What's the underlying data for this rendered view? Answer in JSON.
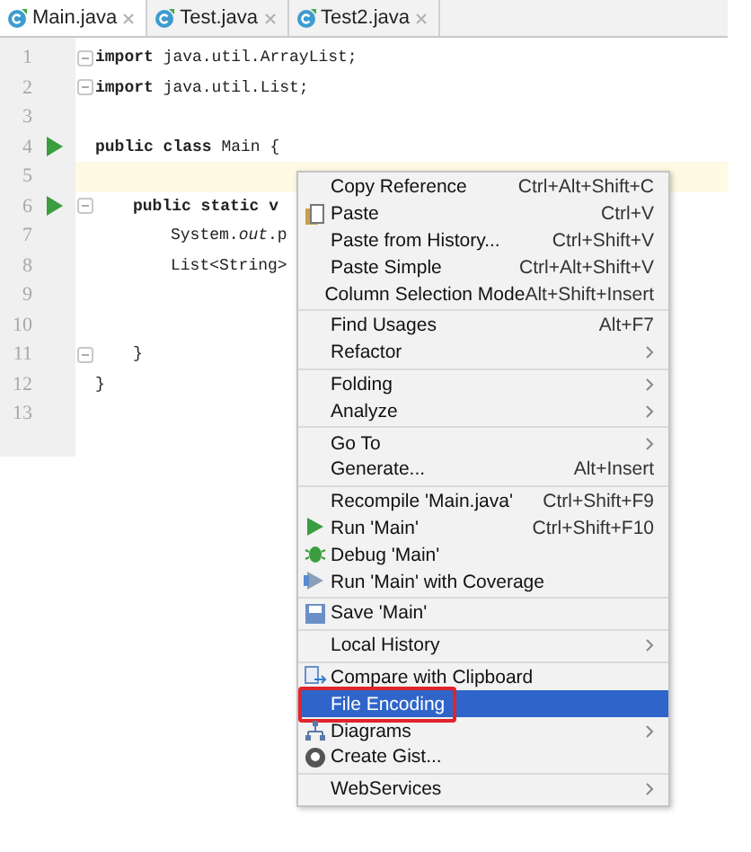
{
  "tabs": [
    {
      "label": "Main.java",
      "selected": true
    },
    {
      "label": "Test.java",
      "selected": false
    },
    {
      "label": "Test2.java",
      "selected": false
    }
  ],
  "editor": {
    "lines": [
      {
        "number": "1",
        "code": "**import** java.util.ArrayList;",
        "kind": "top",
        "fold": true,
        "run": false,
        "current": false
      },
      {
        "number": "2",
        "code": "**import** java.util.List;",
        "kind": "top",
        "fold": true,
        "run": false,
        "current": false
      },
      {
        "number": "3",
        "kind": "top",
        "fold": false,
        "run": false,
        "current": false
      },
      {
        "number": "4",
        "code": "**public class** Main {",
        "kind": "top",
        "fold": false,
        "run": true,
        "current": false
      },
      {
        "number": "5",
        "kind": "top",
        "fold": false,
        "run": false,
        "current": true
      },
      {
        "number": "6",
        "code": "**public static v**",
        "kind": "member",
        "fold": true,
        "run": true,
        "current": false
      },
      {
        "number": "7",
        "code": "System.*out*.p",
        "kind": "statement",
        "fold": false,
        "run": false,
        "current": false
      },
      {
        "number": "8",
        "code": "List<String>",
        "kind": "statement",
        "fold": false,
        "run": false,
        "current": false
      },
      {
        "number": "9",
        "kind": "top",
        "fold": false,
        "run": false,
        "current": false
      },
      {
        "number": "10",
        "kind": "top",
        "fold": false,
        "run": false,
        "current": false
      },
      {
        "number": "11",
        "code": "}",
        "kind": "member",
        "fold": true,
        "run": false,
        "current": false
      },
      {
        "number": "12",
        "code": "}",
        "kind": "top",
        "fold": false,
        "run": false,
        "current": false
      },
      {
        "number": "13",
        "kind": "top",
        "fold": false,
        "run": false,
        "current": false
      }
    ]
  },
  "context_menu": {
    "groups": [
      [
        {
          "label": "Copy Reference",
          "shortcut": "Ctrl+Alt+Shift+C",
          "kind": "plain",
          "submenu": false,
          "selected": false,
          "annotated": false
        },
        {
          "label": "Paste",
          "shortcut": "Ctrl+V",
          "kind": "paste",
          "submenu": false,
          "selected": false,
          "annotated": false
        },
        {
          "label": "Paste from History...",
          "shortcut": "Ctrl+Shift+V",
          "kind": "plain",
          "submenu": false,
          "selected": false,
          "annotated": false
        },
        {
          "label": "Paste Simple",
          "shortcut": "Ctrl+Alt+Shift+V",
          "kind": "plain",
          "submenu": false,
          "selected": false,
          "annotated": false
        },
        {
          "label": "Column Selection Mode",
          "shortcut": "Alt+Shift+Insert",
          "kind": "plain",
          "submenu": false,
          "selected": false,
          "annotated": false
        }
      ],
      [
        {
          "label": "Find Usages",
          "shortcut": "Alt+F7",
          "kind": "plain",
          "submenu": false,
          "selected": false,
          "annotated": false
        },
        {
          "label": "Refactor",
          "kind": "plain",
          "submenu": true,
          "selected": false,
          "annotated": false
        }
      ],
      [
        {
          "label": "Folding",
          "kind": "plain",
          "submenu": true,
          "selected": false,
          "annotated": false
        },
        {
          "label": "Analyze",
          "kind": "plain",
          "submenu": true,
          "selected": false,
          "annotated": false
        }
      ],
      [
        {
          "label": "Go To",
          "kind": "plain",
          "submenu": true,
          "selected": false,
          "annotated": false
        },
        {
          "label": "Generate...",
          "shortcut": "Alt+Insert",
          "kind": "plain",
          "submenu": false,
          "selected": false,
          "annotated": false
        }
      ],
      [
        {
          "label": "Recompile 'Main.java'",
          "shortcut": "Ctrl+Shift+F9",
          "kind": "plain",
          "submenu": false,
          "selected": false,
          "annotated": false
        },
        {
          "label": "Run 'Main'",
          "shortcut": "Ctrl+Shift+F10",
          "kind": "run",
          "submenu": false,
          "selected": false,
          "annotated": false
        },
        {
          "label": "Debug 'Main'",
          "kind": "debug",
          "submenu": false,
          "selected": false,
          "annotated": false
        },
        {
          "label": "Run 'Main' with Coverage",
          "kind": "coverage",
          "submenu": false,
          "selected": false,
          "annotated": false
        }
      ],
      [
        {
          "label": "Save 'Main'",
          "kind": "save",
          "submenu": false,
          "selected": false,
          "annotated": false
        }
      ],
      [
        {
          "label": "Local History",
          "kind": "plain",
          "submenu": true,
          "selected": false,
          "annotated": false
        }
      ],
      [
        {
          "label": "Compare with Clipboard",
          "kind": "compare",
          "submenu": false,
          "selected": false,
          "annotated": false
        },
        {
          "label": "File Encoding",
          "kind": "plain",
          "submenu": false,
          "selected": true,
          "annotated": true
        },
        {
          "label": "Diagrams",
          "kind": "diagram",
          "submenu": true,
          "selected": false,
          "annotated": false
        },
        {
          "label": "Create Gist...",
          "kind": "gist",
          "submenu": false,
          "selected": false,
          "annotated": false
        }
      ],
      [
        {
          "label": "WebServices",
          "kind": "plain",
          "submenu": true,
          "selected": false,
          "annotated": false
        }
      ]
    ]
  }
}
